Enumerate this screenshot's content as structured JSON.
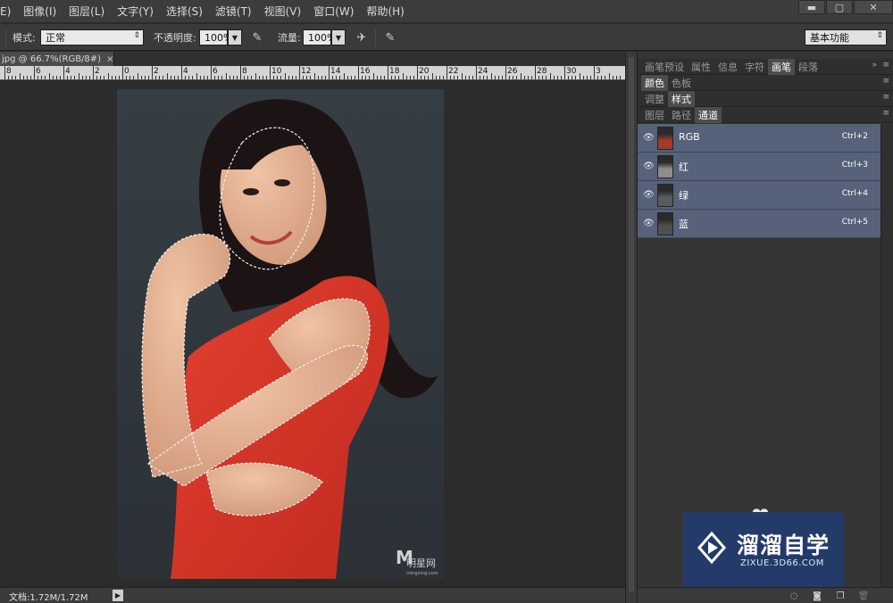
{
  "menubar": {
    "items": [
      "E)",
      "图像(I)",
      "图层(L)",
      "文字(Y)",
      "选择(S)",
      "滤镜(T)",
      "视图(V)",
      "窗口(W)",
      "帮助(H)"
    ],
    "window_buttons": [
      "▬",
      "▢",
      "✕"
    ]
  },
  "options": {
    "mode_label": "模式:",
    "mode_value": "正常",
    "opacity_label": "不透明度:",
    "opacity_value": "100%",
    "flow_label": "流量:",
    "flow_value": "100%",
    "workspace_value": "基本功能"
  },
  "document": {
    "tab_title": "jpg @ 66.7%(RGB/8#)",
    "close_glyph": "×",
    "status_text": "文档:1.72M/1.72M",
    "ruler_labels": [
      "8",
      "6",
      "4",
      "2",
      "0",
      "2",
      "4",
      "6",
      "8",
      "10",
      "12",
      "14",
      "16",
      "18",
      "20",
      "22",
      "24",
      "26",
      "28",
      "30",
      "3"
    ]
  },
  "panels": {
    "row1_tabs": [
      {
        "label": "画笔预设",
        "active": false
      },
      {
        "label": "属性",
        "active": false
      },
      {
        "label": "信息",
        "active": false
      },
      {
        "label": "字符",
        "active": false
      },
      {
        "label": "画笔",
        "active": true
      },
      {
        "label": "段落",
        "active": false
      }
    ],
    "row2_tabs": [
      {
        "label": "颜色",
        "active": true
      },
      {
        "label": "色板",
        "active": false
      }
    ],
    "row3_tabs": [
      {
        "label": "调整",
        "active": false
      },
      {
        "label": "样式",
        "active": true
      }
    ],
    "row4_tabs": [
      {
        "label": "图层",
        "active": false
      },
      {
        "label": "路径",
        "active": false
      },
      {
        "label": "通道",
        "active": true
      }
    ],
    "channels": [
      {
        "name": "RGB",
        "shortcut": "Ctrl+2",
        "thumb_color": "#a33a2a"
      },
      {
        "name": "红",
        "shortcut": "Ctrl+3",
        "thumb_color": "#7a7a7a"
      },
      {
        "name": "绿",
        "shortcut": "Ctrl+4",
        "thumb_color": "#4e4e4e"
      },
      {
        "name": "蓝",
        "shortcut": "Ctrl+5",
        "thumb_color": "#464646"
      }
    ]
  },
  "watermark": {
    "title": "溜溜自学",
    "url": "ZIXUE.3D66.COM",
    "photo_mark": "明星网",
    "photo_mark_sub": "mingxing.com"
  },
  "colors": {
    "dress": "#d9362a",
    "skin": "#d9a588",
    "hair": "#1c1414",
    "backdrop": "#323a40",
    "channel_selected": "#566279",
    "watermark_bg": "#243b6a"
  }
}
